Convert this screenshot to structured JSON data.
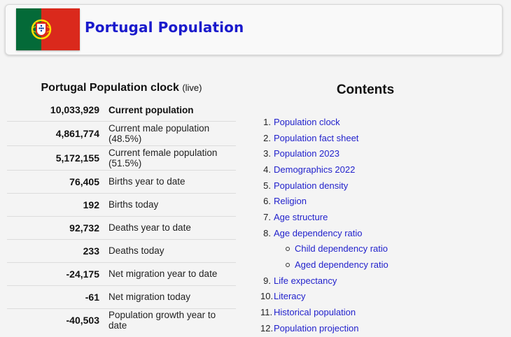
{
  "header": {
    "title": "Portugal Population",
    "flag_colors": {
      "green": "#046a38",
      "red": "#da291c",
      "yellow": "#ffe000"
    }
  },
  "clock": {
    "title": "Portugal Population clock",
    "live": "(live)",
    "rows": [
      {
        "value": "10,033,929",
        "label": "Current population"
      },
      {
        "value": "4,861,774",
        "label": "Current male population (48.5%)"
      },
      {
        "value": "5,172,155",
        "label": "Current female population (51.5%)"
      },
      {
        "value": "76,405",
        "label": "Births year to date"
      },
      {
        "value": "192",
        "label": "Births today"
      },
      {
        "value": "92,732",
        "label": "Deaths year to date"
      },
      {
        "value": "233",
        "label": "Deaths today"
      },
      {
        "value": "-24,175",
        "label": "Net migration year to date"
      },
      {
        "value": "-61",
        "label": "Net migration today"
      },
      {
        "value": "-40,503",
        "label": "Population growth year to date"
      }
    ]
  },
  "contents": {
    "title": "Contents",
    "items": [
      {
        "n": "1.",
        "label": "Population clock"
      },
      {
        "n": "2.",
        "label": "Population fact sheet"
      },
      {
        "n": "3.",
        "label": "Population 2023"
      },
      {
        "n": "4.",
        "label": "Demographics 2022"
      },
      {
        "n": "5.",
        "label": "Population density"
      },
      {
        "n": "6.",
        "label": "Religion"
      },
      {
        "n": "7.",
        "label": "Age structure"
      },
      {
        "n": "8.",
        "label": "Age dependency ratio"
      },
      {
        "n": "9.",
        "label": "Life expectancy"
      },
      {
        "n": "10.",
        "label": "Literacy"
      },
      {
        "n": "11.",
        "label": "Historical population"
      },
      {
        "n": "12.",
        "label": "Population projection"
      }
    ],
    "subitems": [
      {
        "label": "Child dependency ratio"
      },
      {
        "label": "Aged dependency ratio"
      }
    ]
  }
}
